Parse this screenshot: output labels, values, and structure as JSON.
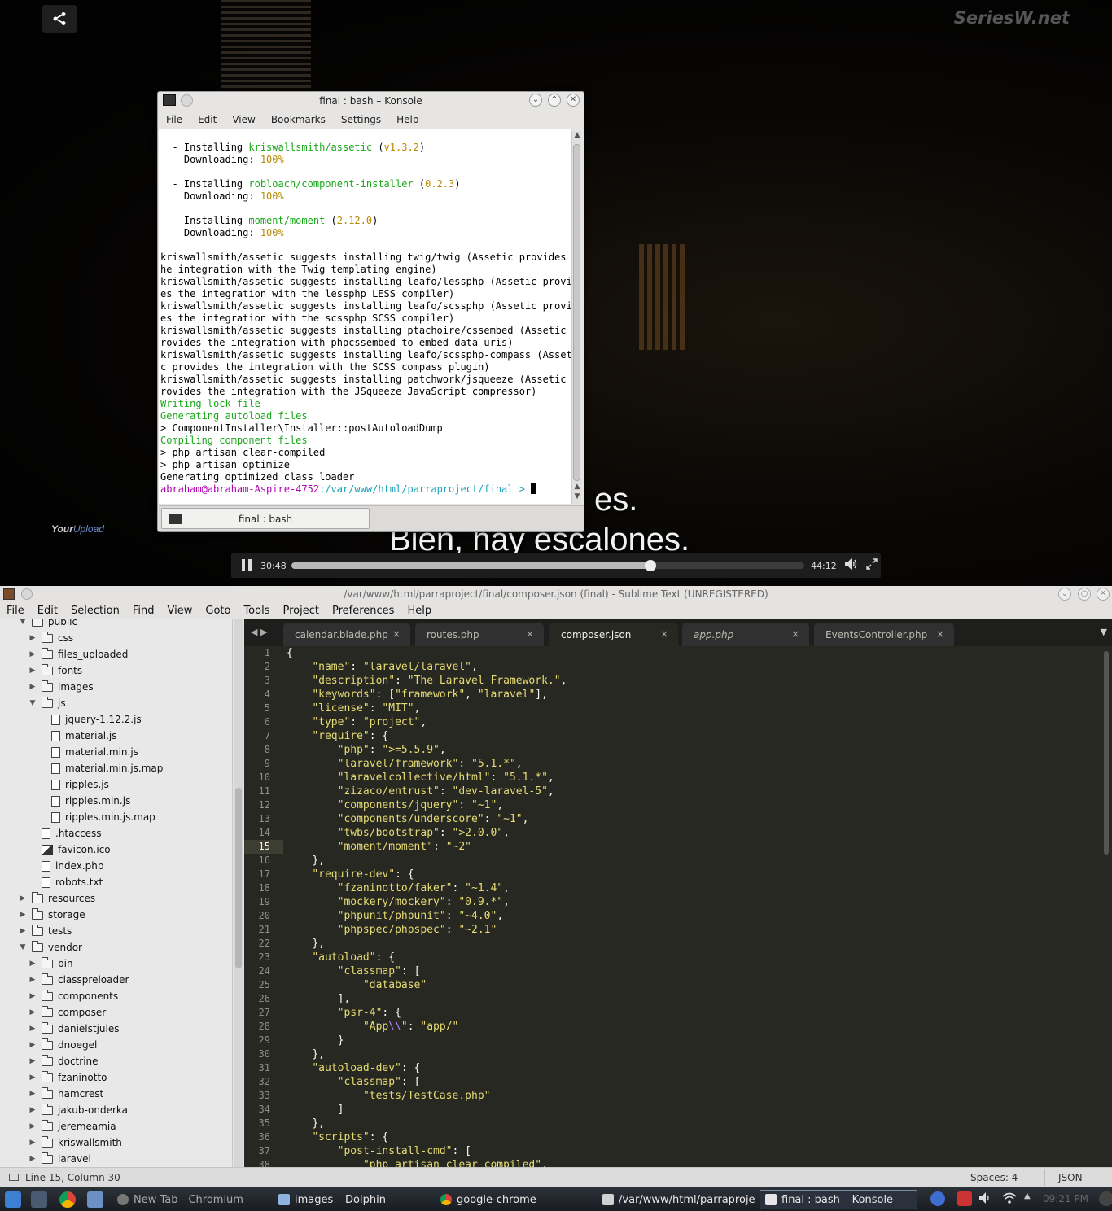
{
  "video": {
    "watermark": "SeriesW.net",
    "brand_a": "Your",
    "brand_b": "Upload",
    "subtitle_line1": "es.",
    "subtitle_line2": "Bien, hay escalones.",
    "current_time": "30:48",
    "total_time": "44:12",
    "progress_fraction": 0.7
  },
  "konsole": {
    "title": "final : bash – Konsole",
    "menu": [
      "File",
      "Edit",
      "View",
      "Bookmarks",
      "Settings",
      "Help"
    ],
    "tab_label": "final : bash",
    "lines": [
      [
        {
          "t": "  - Installing "
        },
        {
          "t": "kriswallsmith/assetic",
          "c": "g"
        },
        {
          "t": " ("
        },
        {
          "t": "v1.3.2",
          "c": "y"
        },
        {
          "t": ")"
        }
      ],
      [
        {
          "t": "    Downloading: "
        },
        {
          "t": "100%",
          "c": "y"
        }
      ],
      [
        {
          "t": ""
        }
      ],
      [
        {
          "t": "  - Installing "
        },
        {
          "t": "robloach/component-installer",
          "c": "g"
        },
        {
          "t": " ("
        },
        {
          "t": "0.2.3",
          "c": "y"
        },
        {
          "t": ")"
        }
      ],
      [
        {
          "t": "    Downloading: "
        },
        {
          "t": "100%",
          "c": "y"
        }
      ],
      [
        {
          "t": ""
        }
      ],
      [
        {
          "t": "  - Installing "
        },
        {
          "t": "moment/moment",
          "c": "g"
        },
        {
          "t": " ("
        },
        {
          "t": "2.12.0",
          "c": "y"
        },
        {
          "t": ")"
        }
      ],
      [
        {
          "t": "    Downloading: "
        },
        {
          "t": "100%",
          "c": "y"
        }
      ],
      [
        {
          "t": ""
        }
      ],
      [
        {
          "t": "kriswallsmith/assetic suggests installing twig/twig (Assetic provides t"
        }
      ],
      [
        {
          "t": "he integration with the Twig templating engine)"
        }
      ],
      [
        {
          "t": "kriswallsmith/assetic suggests installing leafo/lessphp (Assetic provid"
        }
      ],
      [
        {
          "t": "es the integration with the lessphp LESS compiler)"
        }
      ],
      [
        {
          "t": "kriswallsmith/assetic suggests installing leafo/scssphp (Assetic provid"
        }
      ],
      [
        {
          "t": "es the integration with the scssphp SCSS compiler)"
        }
      ],
      [
        {
          "t": "kriswallsmith/assetic suggests installing ptachoire/cssembed (Assetic p"
        }
      ],
      [
        {
          "t": "rovides the integration with phpcssembed to embed data uris)"
        }
      ],
      [
        {
          "t": "kriswallsmith/assetic suggests installing leafo/scssphp-compass (Asseti"
        }
      ],
      [
        {
          "t": "c provides the integration with the SCSS compass plugin)"
        }
      ],
      [
        {
          "t": "kriswallsmith/assetic suggests installing patchwork/jsqueeze (Assetic p"
        }
      ],
      [
        {
          "t": "rovides the integration with the JSqueeze JavaScript compressor)"
        }
      ],
      [
        {
          "t": "Writing lock file",
          "c": "g"
        }
      ],
      [
        {
          "t": "Generating autoload files",
          "c": "g"
        }
      ],
      [
        {
          "t": "> ComponentInstaller\\Installer::postAutoloadDump"
        }
      ],
      [
        {
          "t": "Compiling component files",
          "c": "g"
        }
      ],
      [
        {
          "t": "> php artisan clear-compiled"
        }
      ],
      [
        {
          "t": "> php artisan optimize"
        }
      ],
      [
        {
          "t": "Generating optimized class loader"
        }
      ],
      [
        {
          "t": "abraham@abraham-Aspire-4752",
          "c": "m"
        },
        {
          "t": ":/var/www/html/parraproject/final > ",
          "c": "c"
        }
      ]
    ]
  },
  "sublime": {
    "title": "/var/www/html/parraproject/final/composer.json (final) - Sublime Text (UNREGISTERED)",
    "menu": [
      "File",
      "Edit",
      "Selection",
      "Find",
      "View",
      "Goto",
      "Tools",
      "Project",
      "Preferences",
      "Help"
    ],
    "tabs": [
      {
        "label": "calendar.blade.php",
        "active": false
      },
      {
        "label": "routes.php",
        "active": false
      },
      {
        "label": "composer.json",
        "active": true
      },
      {
        "label": "app.php",
        "active": false
      },
      {
        "label": "EventsController.php",
        "active": false
      }
    ],
    "sidebar": [
      {
        "label": "public",
        "type": "folder",
        "open": true,
        "depth": 0
      },
      {
        "label": "css",
        "type": "folder",
        "open": false,
        "depth": 1
      },
      {
        "label": "files_uploaded",
        "type": "folder",
        "open": false,
        "depth": 1
      },
      {
        "label": "fonts",
        "type": "folder",
        "open": false,
        "depth": 1
      },
      {
        "label": "images",
        "type": "folder",
        "open": false,
        "depth": 1
      },
      {
        "label": "js",
        "type": "folder",
        "open": true,
        "depth": 1
      },
      {
        "label": "jquery-1.12.2.js",
        "type": "file",
        "depth": 2
      },
      {
        "label": "material.js",
        "type": "file",
        "depth": 2
      },
      {
        "label": "material.min.js",
        "type": "file",
        "depth": 2
      },
      {
        "label": "material.min.js.map",
        "type": "file",
        "depth": 2
      },
      {
        "label": "ripples.js",
        "type": "file",
        "depth": 2
      },
      {
        "label": "ripples.min.js",
        "type": "file",
        "depth": 2
      },
      {
        "label": "ripples.min.js.map",
        "type": "file",
        "depth": 2
      },
      {
        "label": ".htaccess",
        "type": "file",
        "depth": 1
      },
      {
        "label": "favicon.ico",
        "type": "image",
        "depth": 1
      },
      {
        "label": "index.php",
        "type": "file",
        "depth": 1
      },
      {
        "label": "robots.txt",
        "type": "file",
        "depth": 1
      },
      {
        "label": "resources",
        "type": "folder",
        "open": false,
        "depth": 0
      },
      {
        "label": "storage",
        "type": "folder",
        "open": false,
        "depth": 0
      },
      {
        "label": "tests",
        "type": "folder",
        "open": false,
        "depth": 0
      },
      {
        "label": "vendor",
        "type": "folder",
        "open": true,
        "depth": 0
      },
      {
        "label": "bin",
        "type": "folder",
        "open": false,
        "depth": 1
      },
      {
        "label": "classpreloader",
        "type": "folder",
        "open": false,
        "depth": 1
      },
      {
        "label": "components",
        "type": "folder",
        "open": false,
        "depth": 1
      },
      {
        "label": "composer",
        "type": "folder",
        "open": false,
        "depth": 1
      },
      {
        "label": "danielstjules",
        "type": "folder",
        "open": false,
        "depth": 1
      },
      {
        "label": "dnoegel",
        "type": "folder",
        "open": false,
        "depth": 1
      },
      {
        "label": "doctrine",
        "type": "folder",
        "open": false,
        "depth": 1
      },
      {
        "label": "fzaninotto",
        "type": "folder",
        "open": false,
        "depth": 1
      },
      {
        "label": "hamcrest",
        "type": "folder",
        "open": false,
        "depth": 1
      },
      {
        "label": "jakub-onderka",
        "type": "folder",
        "open": false,
        "depth": 1
      },
      {
        "label": "jeremeamia",
        "type": "folder",
        "open": false,
        "depth": 1
      },
      {
        "label": "kriswallsmith",
        "type": "folder",
        "open": false,
        "depth": 1
      },
      {
        "label": "laravel",
        "type": "folder",
        "open": false,
        "depth": 1
      }
    ],
    "current_line": 15,
    "code": [
      "{",
      "    \"name\": \"laravel/laravel\",",
      "    \"description\": \"The Laravel Framework.\",",
      "    \"keywords\": [\"framework\", \"laravel\"],",
      "    \"license\": \"MIT\",",
      "    \"type\": \"project\",",
      "    \"require\": {",
      "        \"php\": \">=5.5.9\",",
      "        \"laravel/framework\": \"5.1.*\",",
      "        \"laravelcollective/html\": \"5.1.*\",",
      "        \"zizaco/entrust\": \"dev-laravel-5\",",
      "        \"components/jquery\": \"~1\",",
      "        \"components/underscore\": \"~1\",",
      "        \"twbs/bootstrap\": \">2.0.0\",",
      "        \"moment/moment\": \"~2\"",
      "    },",
      "    \"require-dev\": {",
      "        \"fzaninotto/faker\": \"~1.4\",",
      "        \"mockery/mockery\": \"0.9.*\",",
      "        \"phpunit/phpunit\": \"~4.0\",",
      "        \"phpspec/phpspec\": \"~2.1\"",
      "    },",
      "    \"autoload\": {",
      "        \"classmap\": [",
      "            \"database\"",
      "        ],",
      "        \"psr-4\": {",
      "            \"App\\\\\": \"app/\"",
      "        }",
      "    },",
      "    \"autoload-dev\": {",
      "        \"classmap\": [",
      "            \"tests/TestCase.php\"",
      "        ]",
      "    },",
      "    \"scripts\": {",
      "        \"post-install-cmd\": [",
      "            \"php artisan clear-compiled\","
    ],
    "status_position": "Line 15, Column 30",
    "status_spaces": "Spaces: 4",
    "status_syntax": "JSON"
  },
  "taskbar": {
    "tasks": [
      {
        "label": "New Tab - Chromium",
        "active": false
      },
      {
        "label": "images – Dolphin",
        "active": false
      },
      {
        "label": "google-chrome",
        "active": false
      },
      {
        "label": "/var/www/html/parraproject/",
        "active": false
      },
      {
        "label": "final : bash – Konsole",
        "active": true
      }
    ],
    "clock": "09:21 PM"
  }
}
